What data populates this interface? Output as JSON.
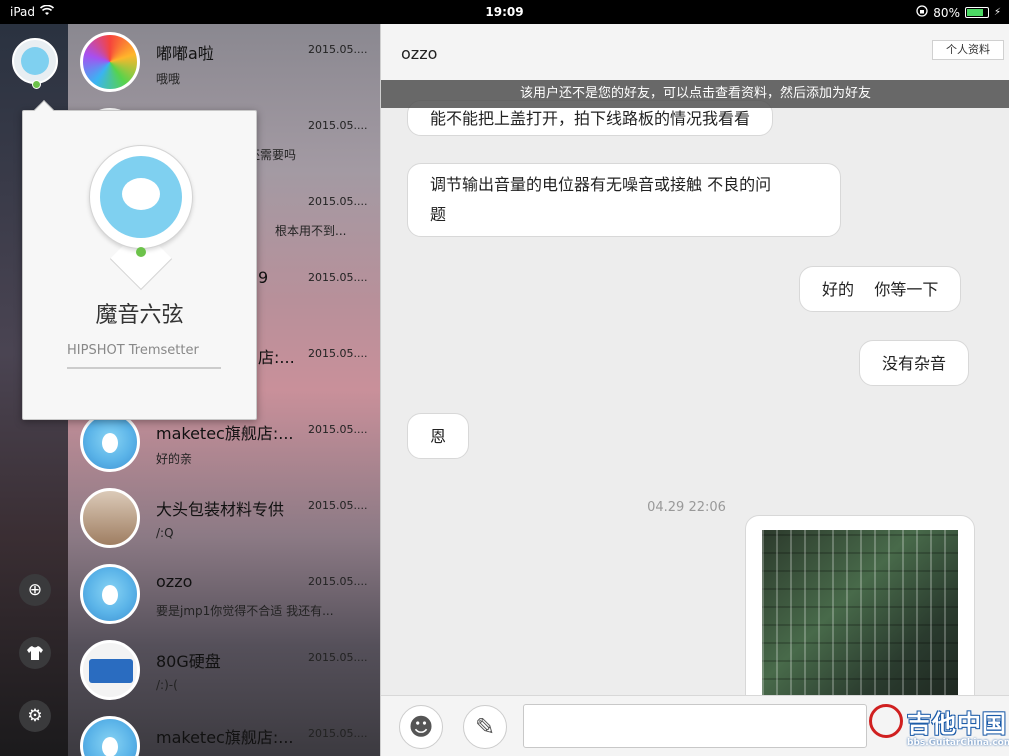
{
  "status_bar": {
    "device": "iPad",
    "time": "19:09",
    "battery": "80%",
    "battery_fraction": 0.8,
    "icons": [
      "wifi-icon",
      "orientation-lock-icon",
      "battery-icon"
    ]
  },
  "rail": {
    "buttons": [
      "add-contact-icon",
      "shirt-icon",
      "gear-icon"
    ]
  },
  "conversations": [
    {
      "name": "嘟嘟a啦",
      "date": "2015.05....",
      "preview": "哦哦",
      "avatar": "game"
    },
    {
      "name": "",
      "date": "2015.05....",
      "preview": "还需要吗",
      "avatar": "qq"
    },
    {
      "name": "",
      "date": "2015.05....",
      "preview": "根本用不到...",
      "avatar": "qq"
    },
    {
      "name": "9",
      "date": "2015.05....",
      "preview": "",
      "avatar": "qq"
    },
    {
      "name": "店:...",
      "date": "2015.05....",
      "preview": "",
      "avatar": "qq"
    },
    {
      "name": "maketec旗舰店:...",
      "date": "2015.05....",
      "preview": "好的亲",
      "avatar": "qq"
    },
    {
      "name": "大头包装材料专供",
      "date": "2015.05....",
      "preview": "/:Q",
      "avatar": "photo"
    },
    {
      "name": "ozzo",
      "date": "2015.05....",
      "preview": "要是jmp1你觉得不合适  我还有...",
      "avatar": "qq"
    },
    {
      "name": "80G硬盘",
      "date": "2015.05....",
      "preview": "/:)-(",
      "avatar": "card"
    },
    {
      "name": "maketec旗舰店:...",
      "date": "2015.05....",
      "preview": "",
      "avatar": "qq"
    }
  ],
  "profile_popover": {
    "nickname": "魔音六弦",
    "signature": "HIPSHOT Tremsetter"
  },
  "chat": {
    "title": "ozzo",
    "profile_button": "个人资料",
    "notice": "该用户还不是您的好友，可以点击查看资料，然后添加为好友",
    "messages": [
      {
        "side": "left",
        "text": "能不能把上盖打开，拍下线路板的情况我看看"
      },
      {
        "side": "left",
        "text_line1": "调节输出音量的电位器有无噪音或接触 不良的问",
        "text_line2": "题"
      },
      {
        "side": "right",
        "text": "好的    你等一下"
      },
      {
        "side": "right",
        "text": "没有杂音"
      },
      {
        "side": "left",
        "text": "恩"
      }
    ],
    "timestamp": "04.29 22:06"
  },
  "composer": {
    "emoji_icon": "smiley-icon",
    "edit_icon": "edit-note-icon",
    "input_value": ""
  },
  "watermark": {
    "title": "吉他中国",
    "subtitle": "bbs.GuitarChina.com"
  }
}
